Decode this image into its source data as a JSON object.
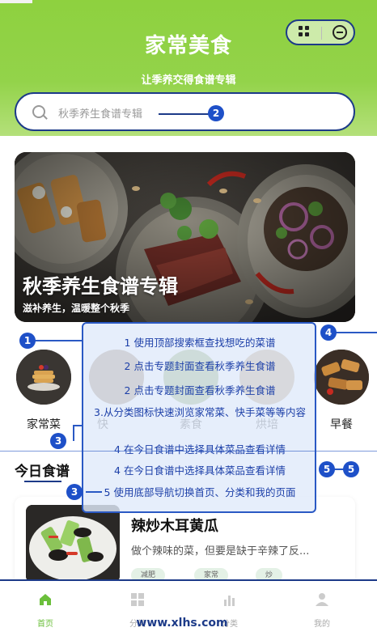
{
  "app": {
    "title": "家常美食",
    "subtitle": "让季养交得食谱专辑"
  },
  "search": {
    "placeholder": "秋季养生食谱专辑"
  },
  "banner": {
    "title": "秋季养生食谱专辑",
    "subtitle": "滋补养生，温暖整个秋季"
  },
  "categories": [
    {
      "label": "家常菜"
    },
    {
      "label": "快"
    },
    {
      "label": "素食"
    },
    {
      "label": "烘培"
    },
    {
      "label": "早餐"
    }
  ],
  "today": {
    "title": "今日食谱",
    "recipe": {
      "name": "辣炒木耳黄瓜",
      "description": "做个辣味的菜，但要是缺于辛辣了反...",
      "tags": [
        "减肥",
        "家常",
        "炒"
      ]
    }
  },
  "nav": {
    "items": [
      {
        "label": "首页",
        "icon": "home-icon"
      },
      {
        "label": "分类",
        "icon": "grid-icon"
      },
      {
        "label": "分类",
        "icon": "chart-icon"
      },
      {
        "label": "我的",
        "icon": "user-icon"
      }
    ]
  },
  "watermark": "www.xlhs.com",
  "tutorial": {
    "steps": [
      "1 使用顶部搜索框查找想吃的菜谱",
      "2 点击专题封面查看秋季养生食谱",
      "2 点击专题封面查看秋季养生食谱",
      "3.从分类图标快速浏览家常菜、快手菜等等内容",
      "4 在今日食谱中选择具体菜品查看详情",
      "4 在今日食谱中选择具体菜品查看详情",
      "5 使用底部导航切换首页、分类和我的页面"
    ],
    "badges": [
      "1",
      "2",
      "3",
      "3",
      "4",
      "5",
      "5"
    ]
  },
  "colors": {
    "header_green": "#8ed13f",
    "annotation_blue": "#1e50c8",
    "nav_active": "#6bbf3b"
  }
}
